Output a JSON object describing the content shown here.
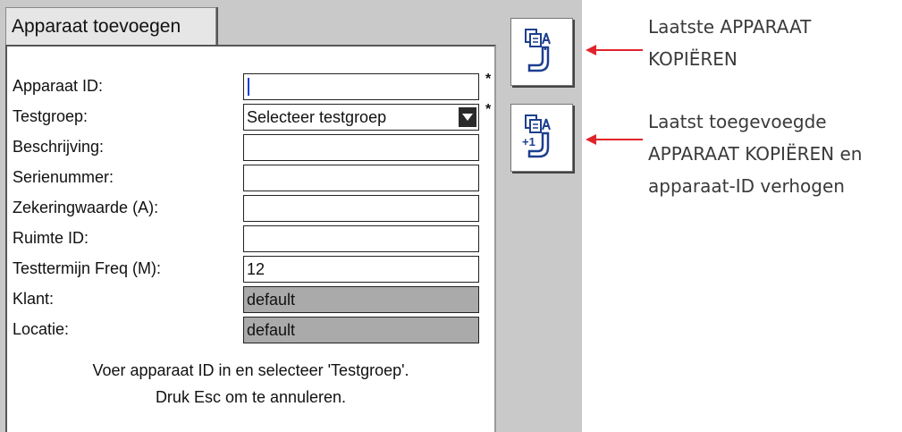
{
  "window": {
    "tab_title": "Apparaat toevoegen"
  },
  "form": {
    "fields": [
      {
        "label": "Apparaat ID:",
        "value": "",
        "required_mark": "*"
      },
      {
        "label": "Testgroep:",
        "value": "Selecteer testgroep",
        "required_mark": "*"
      },
      {
        "label": "Beschrijving:",
        "value": ""
      },
      {
        "label": "Serienummer:",
        "value": ""
      },
      {
        "label": "Zekeringwaarde (A):",
        "value": ""
      },
      {
        "label": "Ruimte ID:",
        "value": ""
      },
      {
        "label": "Testtermijn Freq (M):",
        "value": "12"
      },
      {
        "label": "Klant:",
        "value": "default"
      },
      {
        "label": "Locatie:",
        "value": "default"
      }
    ],
    "hint_line1": "Voer apparaat ID in en selecteer 'Testgroep'.",
    "hint_line2": "Druk Esc om te annuleren."
  },
  "side_buttons": {
    "copy_last": {
      "icon": "copy-device-icon"
    },
    "copy_increment": {
      "icon": "copy-device-increment-icon",
      "badge": "+1"
    }
  },
  "annotations": {
    "note1_line1": "Laatste APPARAAT",
    "note1_line2": "KOPIËREN",
    "note2_line1": "Laatst toegevoegde",
    "note2_line2": "APPARAAT KOPIËREN en",
    "note2_line3": "apparaat-ID verhogen",
    "arrow_color": "#e0242b"
  },
  "colors": {
    "screen_bg": "#c9c9c9",
    "readonly_field": "#aaaaaa"
  }
}
